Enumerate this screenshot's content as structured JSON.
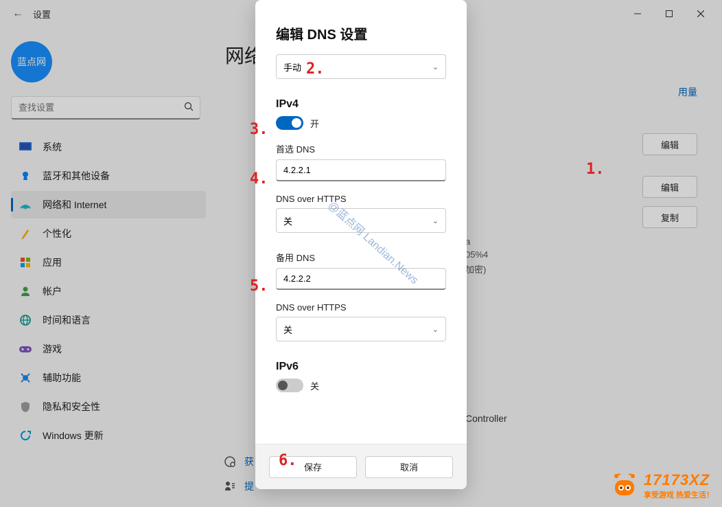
{
  "window": {
    "title": "设置"
  },
  "avatar": {
    "label": "蓝点网"
  },
  "search": {
    "placeholder": "查找设置"
  },
  "nav": {
    "items": [
      {
        "label": "系统",
        "icon_bg": "#2a6fd6"
      },
      {
        "label": "蓝牙和其他设备",
        "icon_bg": "#0a84ff"
      },
      {
        "label": "网络和 Internet",
        "icon_bg": "#00bcd4"
      },
      {
        "label": "个性化",
        "icon_bg": "#ffb300"
      },
      {
        "label": "应用",
        "icon_bg": "#607d8b"
      },
      {
        "label": "帐户",
        "icon_bg": "#43a047"
      },
      {
        "label": "时间和语言",
        "icon_bg": "#26a69a"
      },
      {
        "label": "游戏",
        "icon_bg": "#7e57c2"
      },
      {
        "label": "辅助功能",
        "icon_bg": "#1e88e5"
      },
      {
        "label": "隐私和安全性",
        "icon_bg": "#9e9e9e"
      },
      {
        "label": "Windows 更新",
        "icon_bg": "#039be5"
      }
    ],
    "active_index": 2
  },
  "content": {
    "page_title": "网络",
    "usage_link": "用量",
    "btn_edit": "编辑",
    "btn_copy": "复制",
    "info": {
      "line1": "a",
      "line2": "05%4",
      "line3": "加密)",
      "controller": "Controller"
    },
    "helper1": "获",
    "helper2": "提"
  },
  "dialog": {
    "title": "编辑 DNS 设置",
    "mode_value": "手动",
    "ipv4": {
      "heading": "IPv4",
      "on_label": "开",
      "primary_label": "首选 DNS",
      "primary_value": "4.2.2.1",
      "doh_label": "DNS over HTTPS",
      "doh_value": "关",
      "alt_label": "备用 DNS",
      "alt_value": "4.2.2.2",
      "doh2_value": "关"
    },
    "ipv6": {
      "heading": "IPv6",
      "off_label": "关"
    },
    "save": "保存",
    "cancel": "取消"
  },
  "annotations": {
    "a1": "1.",
    "a2": "2.",
    "a3": "3.",
    "a4": "4.",
    "a5": "5.",
    "a6": "6."
  },
  "watermark": "@蓝点网 Landian.News",
  "brand": {
    "name": "17173XZ",
    "tagline": "享受游戏  热爱生活！"
  }
}
